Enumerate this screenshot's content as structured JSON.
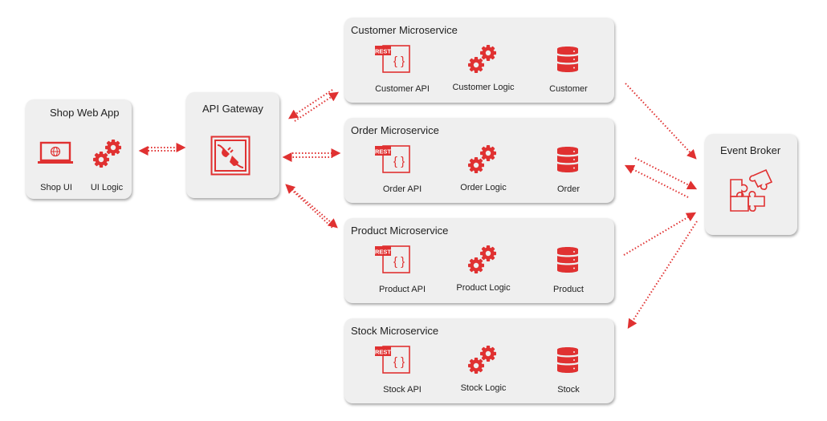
{
  "accent_color": "#e03131",
  "shop_web_app": {
    "title": "Shop Web App",
    "components": [
      {
        "label": "Shop UI",
        "icon": "laptop-globe-icon"
      },
      {
        "label": "UI Logic",
        "icon": "gears-icon"
      }
    ]
  },
  "api_gateway": {
    "title": "API Gateway",
    "icon": "plug-connector-icon"
  },
  "microservices": [
    {
      "title": "Customer Microservice",
      "api": "Customer API",
      "logic": "Customer Logic",
      "db": "Customer",
      "rest_badge": "REST"
    },
    {
      "title": "Order Microservice",
      "api": "Order API",
      "logic": "Order Logic",
      "db": "Order",
      "rest_badge": "REST"
    },
    {
      "title": "Product Microservice",
      "api": "Product API",
      "logic": "Product Logic",
      "db": "Product",
      "rest_badge": "REST"
    },
    {
      "title": "Stock Microservice",
      "api": "Stock API",
      "logic": "Stock Logic",
      "db": "Stock",
      "rest_badge": "REST"
    }
  ],
  "event_broker": {
    "title": "Event Broker",
    "icon": "puzzle-icon"
  },
  "connections": [
    {
      "from": "Shop Web App",
      "to": "API Gateway",
      "direction": "bidirectional"
    },
    {
      "from": "API Gateway",
      "to": "Customer Microservice",
      "direction": "bidirectional"
    },
    {
      "from": "API Gateway",
      "to": "Order Microservice",
      "direction": "bidirectional"
    },
    {
      "from": "API Gateway",
      "to": "Product Microservice",
      "direction": "bidirectional"
    },
    {
      "from": "Customer Microservice",
      "to": "Event Broker",
      "direction": "forward"
    },
    {
      "from": "Order Microservice",
      "to": "Event Broker",
      "direction": "bidirectional"
    },
    {
      "from": "Product Microservice",
      "to": "Event Broker",
      "direction": "forward"
    },
    {
      "from": "Event Broker",
      "to": "Stock Microservice",
      "direction": "forward"
    }
  ]
}
